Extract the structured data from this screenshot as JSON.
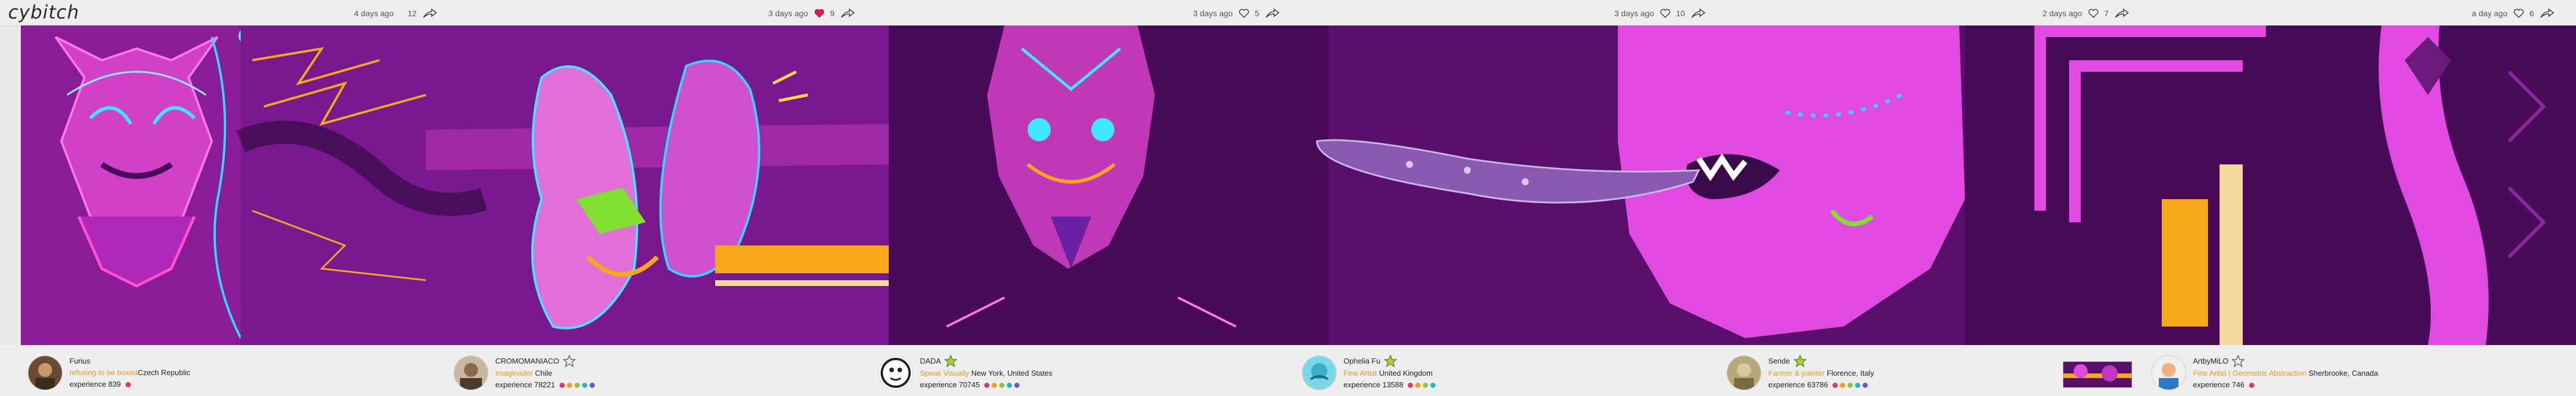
{
  "brand": {
    "logo": "cybitch"
  },
  "posts": [
    {
      "time": "4 days ago",
      "likes": "12",
      "liked": false
    },
    {
      "time": "3 days ago",
      "likes": "9",
      "liked": true
    },
    {
      "time": "3 days ago",
      "likes": "5",
      "liked": false
    },
    {
      "time": "3 days ago",
      "likes": "10",
      "liked": false
    },
    {
      "time": "2 days ago",
      "likes": "7",
      "liked": false
    },
    {
      "time": "a day ago",
      "likes": "6",
      "liked": false
    }
  ],
  "artists": [
    {
      "name": "Furius",
      "role": "refusing to be boxed",
      "location": "Czech Republic",
      "experience": "experience 839",
      "star": "none",
      "dots": [
        "#e8335a"
      ]
    },
    {
      "name": "CROMOMANIACO",
      "role": "Imaginador",
      "location": "Chile",
      "experience": "experience 78221",
      "star": "outline",
      "dots": [
        "#e8335a",
        "#f0a020",
        "#8cc63f",
        "#2ab0d8",
        "#6a5acd"
      ]
    },
    {
      "name": "DADA",
      "role": "Speak Visually",
      "location": "New York, United States",
      "experience": "experience 70745",
      "star": "green",
      "dots": [
        "#e8335a",
        "#f0a020",
        "#8cc63f",
        "#2ab0d8",
        "#6a5acd"
      ]
    },
    {
      "name": "Ophelia Fu",
      "role": "Fine Artist",
      "location": "United Kingdom",
      "experience": "experience 13588",
      "star": "green",
      "dots": [
        "#e8335a",
        "#f0a020",
        "#8cc63f",
        "#2ab0d8"
      ]
    },
    {
      "name": "Sende",
      "role": "Farmer & painter",
      "location": "Florence, Italy",
      "experience": "experience 63786",
      "star": "green",
      "dots": [
        "#e8335a",
        "#f0a020",
        "#8cc63f",
        "#2ab0d8",
        "#6a5acd"
      ]
    },
    {
      "name": "ArtbyMiLO",
      "role": "Fine Artist | Geometric Abstraction",
      "location": "Sherbrooke, Canada",
      "experience": "experience 746",
      "star": "outline",
      "dots": [
        "#e8335a"
      ]
    }
  ],
  "colors": {
    "accent": "#e69a1f",
    "liked": "#e0194f",
    "magenta": "#d63bd0",
    "deep": "#4a0a5a",
    "orange": "#f5a81a"
  }
}
